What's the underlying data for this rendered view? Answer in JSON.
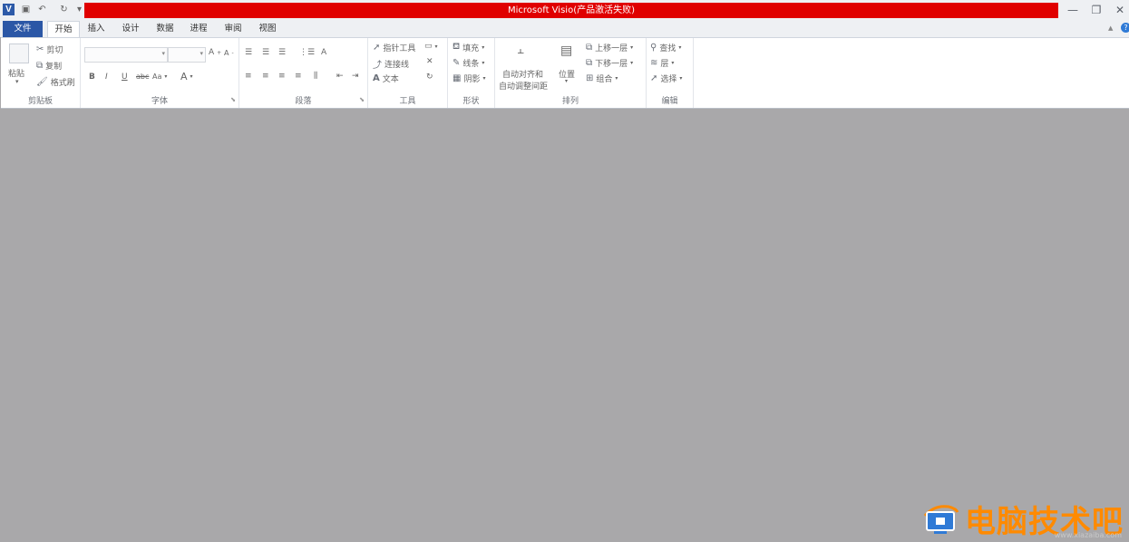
{
  "title_bar": {
    "title": "Microsoft Visio(产品激活失败)",
    "qat": {
      "app_icon": "V",
      "save": "💾",
      "undo": "↶",
      "redo": "↻",
      "customize": "▾"
    },
    "window": {
      "minimize": "—",
      "restore": "❐",
      "close": "✕"
    }
  },
  "tabs": [
    "文件",
    "开始",
    "插入",
    "设计",
    "数据",
    "进程",
    "审阅",
    "视图"
  ],
  "help": {
    "collapse": "▲",
    "help": "?"
  },
  "ribbon": {
    "clipboard": {
      "label": "剪贴板",
      "paste": "粘贴",
      "cut": "剪切",
      "copy": "复制",
      "format_painter": "格式刷"
    },
    "font": {
      "label": "字体",
      "bold": "B",
      "italic": "I",
      "underline": "U",
      "strike": "abc",
      "case": "Aa",
      "grow": "A",
      "shrink": "A",
      "color": "A"
    },
    "paragraph": {
      "label": "段落"
    },
    "tools": {
      "label": "工具",
      "pointer": "指针工具",
      "connector": "连接线",
      "text": "文本"
    },
    "shape": {
      "label": "形状",
      "fill": "填充",
      "line": "线条",
      "shadow": "阴影"
    },
    "arrange": {
      "label": "排列",
      "auto_align": "自动对齐和",
      "auto_space": "自动调整间距",
      "position": "位置",
      "bring_forward": "上移一层",
      "send_backward": "下移一层",
      "group": "组合"
    },
    "editing": {
      "label": "编辑",
      "find": "查找",
      "layers": "层",
      "select": "选择"
    }
  },
  "watermark": {
    "text": "电脑技术吧",
    "url": "www.xiazaiba.com"
  },
  "colors": {
    "title_red": "#e00000",
    "file_tab": "#2b57a6",
    "canvas": "#a9a8aa",
    "watermark": "#ff8a00"
  }
}
